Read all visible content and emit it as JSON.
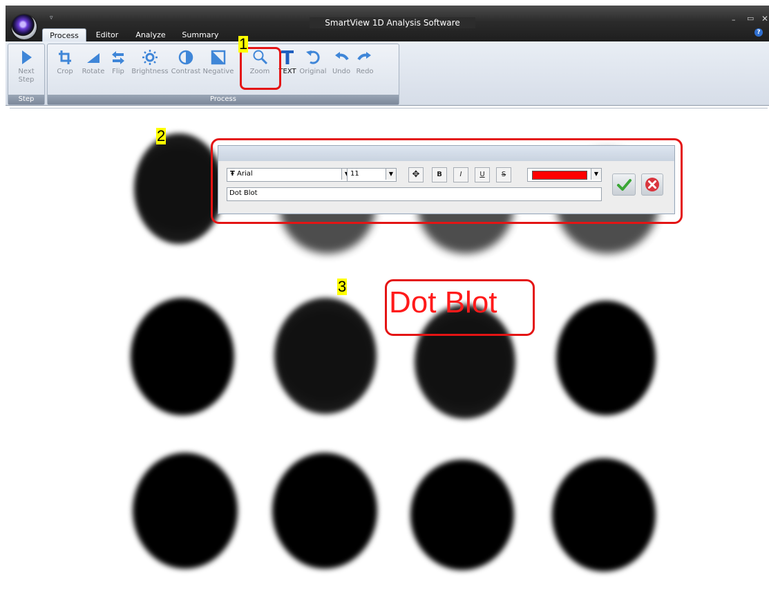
{
  "window": {
    "title": "SmartView 1D Analysis Software",
    "quick_menu": "▿",
    "minimize": "–",
    "maximize": "▭",
    "close": "✕",
    "help": "?"
  },
  "tabs": [
    {
      "label": "Process",
      "active": true
    },
    {
      "label": "Editor"
    },
    {
      "label": "Analyze"
    },
    {
      "label": "Summary"
    }
  ],
  "ribbon": {
    "step_group": {
      "label": "Step",
      "next_step": "Next\nStep"
    },
    "process_group": {
      "label": "Process",
      "buttons": [
        {
          "label": "Crop",
          "icon": "crop-icon"
        },
        {
          "label": "Rotate",
          "icon": "rotate-icon"
        },
        {
          "label": "Flip",
          "icon": "flip-icon"
        },
        {
          "label": "Brightness",
          "icon": "brightness-icon"
        },
        {
          "label": "Contrast",
          "icon": "contrast-icon"
        },
        {
          "label": "Negative",
          "icon": "negative-icon"
        },
        {
          "label": "Zoom",
          "icon": "zoom-icon"
        },
        {
          "label": "TEXT",
          "icon": "text-icon",
          "active": true
        },
        {
          "label": "Original",
          "icon": "original-icon"
        },
        {
          "label": "Undo",
          "icon": "undo-icon"
        },
        {
          "label": "Redo",
          "icon": "redo-icon"
        }
      ]
    }
  },
  "text_dialog": {
    "font_name": "Arial",
    "font_icon": "Ŧ",
    "font_size": "11",
    "move": "✥",
    "bold": "B",
    "italic": "I",
    "underline": "U",
    "strike": "S",
    "color": "#ff0000",
    "text_value": "Dot Blot",
    "dropdown_arrow": "▼"
  },
  "image": {
    "overlay_text": "Dot Blot",
    "overlay_color": "#ff1a1a"
  },
  "annotations": {
    "marker_1": "1",
    "marker_2": "2",
    "marker_3": "3",
    "callout_color": "#e41414",
    "marker_color": "#ffff00"
  }
}
